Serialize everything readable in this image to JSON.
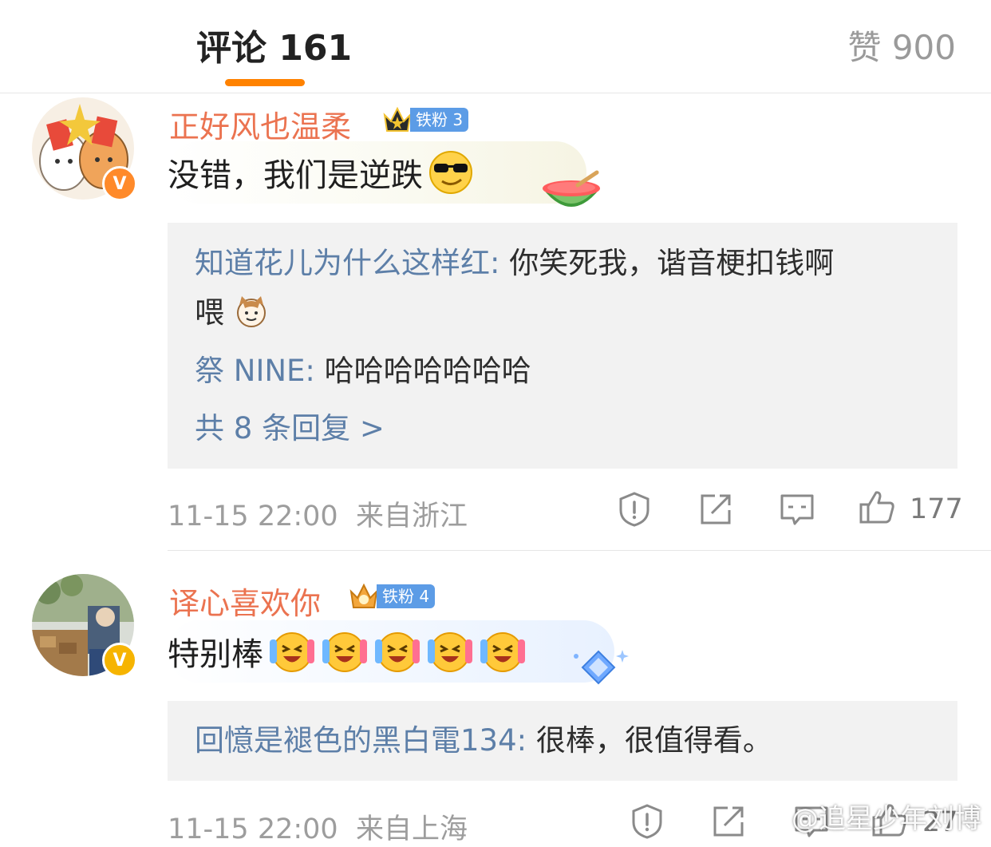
{
  "header": {
    "comments_tab": "评论 161",
    "likes_tab": "赞 900",
    "accent_color": "#ff8200"
  },
  "comments": [
    {
      "username": "正好风也温柔",
      "fan_badge": "铁粉 3",
      "text": "没错，我们是逆跌",
      "emoji": "cool-sunglasses-emoji",
      "sticker": "watermelon-icon",
      "replies": [
        {
          "user": "知道花儿为什么这样红",
          "sep": ": ",
          "text": "你笑死我，谐音梗扣钱啊",
          "text2": "喂"
        },
        {
          "user": "祭 NINE",
          "sep": ": ",
          "text": "哈哈哈哈哈哈哈"
        }
      ],
      "more_replies": "共 8 条回复 >",
      "time": "11-15 22:00",
      "location": "来自浙江",
      "likes": "177"
    },
    {
      "username": "译心喜欢你",
      "fan_badge": "铁粉 4",
      "text": "特别棒",
      "emoji": "laughing-cry-emoji",
      "sticker": "diamond-icon",
      "replies": [
        {
          "user": "回憶是褪色的黑白電134",
          "sep": ": ",
          "text": "很棒，很值得看。"
        }
      ],
      "time": "11-15 22:00",
      "location": "来自上海",
      "likes": "27"
    }
  ],
  "watermark": "@追星少年刘博"
}
